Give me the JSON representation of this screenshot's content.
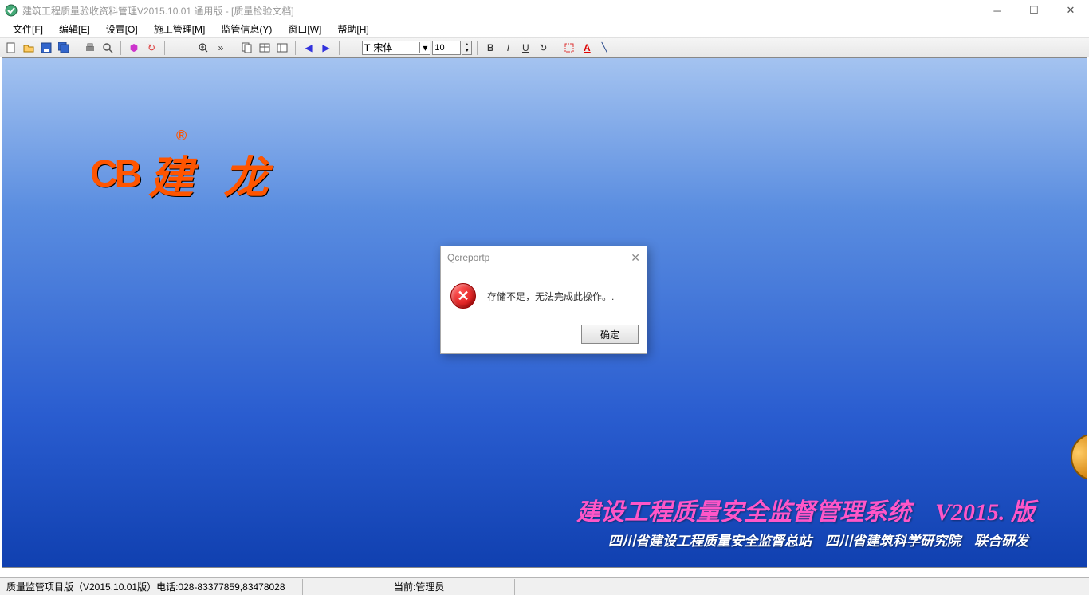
{
  "title": "建筑工程质量验收资料管理V2015.10.01  通用版 - [质量检验文档]",
  "menu": {
    "file": "文件[F]",
    "edit": "编辑[E]",
    "settings": "设置[O]",
    "construction": "施工管理[M]",
    "supervision": "监管信息(Y)",
    "window": "窗口[W]",
    "help": "帮助[H]"
  },
  "toolbar": {
    "font_label_prefix": "T",
    "font_name": "宋体",
    "font_size": "10",
    "bold": "B",
    "italic": "I",
    "underline": "U"
  },
  "logo": {
    "mark": "CB",
    "registered": "®",
    "brand": "建 龙"
  },
  "banner": {
    "title": "建设工程质量安全监督管理系统　V2015. 版",
    "subtitle": "四川省建设工程质量安全监督总站　四川省建筑科学研究院　联合研发"
  },
  "dialog": {
    "title": "Qcreportp",
    "message": "存储不足，无法完成此操作。.",
    "ok": "确定"
  },
  "status": {
    "version": "质量监管项目版（V2015.10.01版）电话:028-83377859,83478028",
    "user_label": "当前:管理员"
  }
}
